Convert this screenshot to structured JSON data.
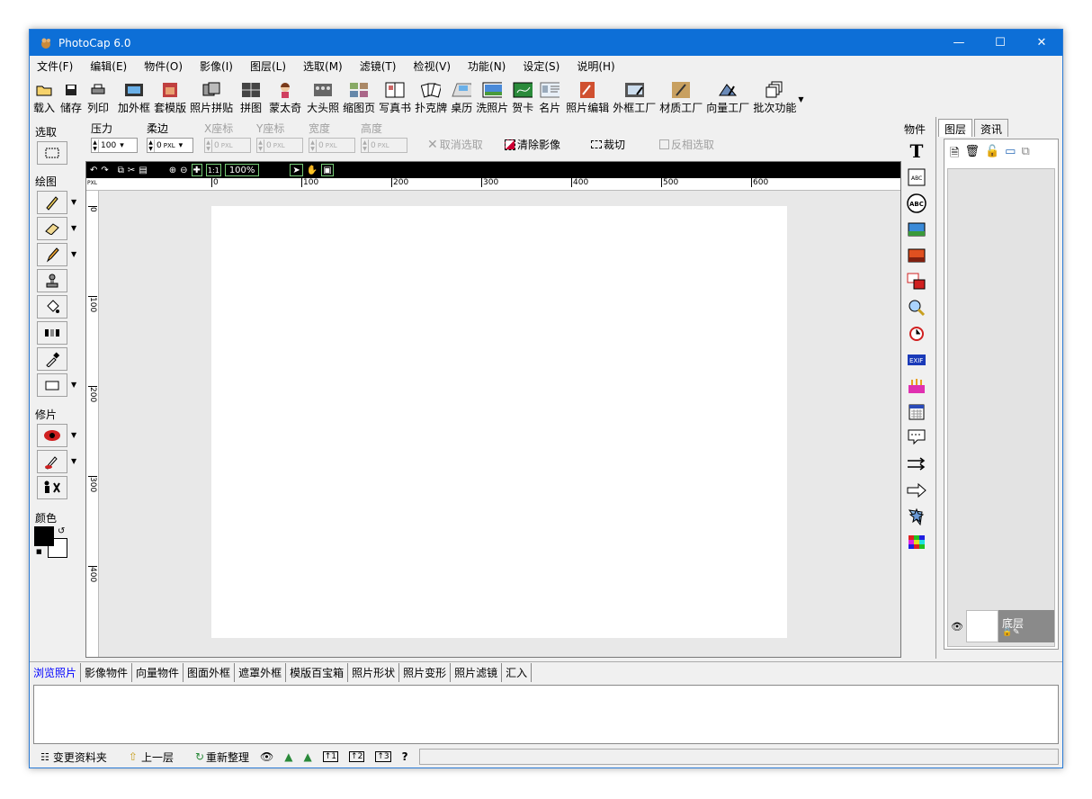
{
  "window": {
    "title": "PhotoCap 6.0",
    "controls": [
      "minimize-icon",
      "maximize-icon",
      "close-icon"
    ]
  },
  "menu": [
    "文件(F)",
    "编辑(E)",
    "物件(O)",
    "影像(I)",
    "图层(L)",
    "选取(M)",
    "滤镜(T)",
    "检视(V)",
    "功能(N)",
    "设定(S)",
    "说明(H)"
  ],
  "toolbar": [
    {
      "label": "载入",
      "icon": "open-folder-icon"
    },
    {
      "label": "储存",
      "icon": "save-icon"
    },
    {
      "label": "列印",
      "icon": "printer-icon"
    },
    {
      "label": "加外框",
      "icon": "frame-icon"
    },
    {
      "label": "套模版",
      "icon": "template-icon"
    },
    {
      "label": "照片拼贴",
      "icon": "collage-icon"
    },
    {
      "label": "拼图",
      "icon": "puzzle-icon"
    },
    {
      "label": "蒙太奇",
      "icon": "montage-icon"
    },
    {
      "label": "大头照",
      "icon": "id-photo-icon"
    },
    {
      "label": "缩图页",
      "icon": "thumbnail-page-icon"
    },
    {
      "label": "写真书",
      "icon": "photobook-icon"
    },
    {
      "label": "扑克牌",
      "icon": "poker-icon"
    },
    {
      "label": "桌历",
      "icon": "desk-calendar-icon"
    },
    {
      "label": "洗照片",
      "icon": "print-photo-icon"
    },
    {
      "label": "贺卡",
      "icon": "greeting-card-icon"
    },
    {
      "label": "名片",
      "icon": "business-card-icon"
    },
    {
      "label": "照片编辑",
      "icon": "photo-edit-icon"
    },
    {
      "label": "外框工厂",
      "icon": "frame-factory-icon"
    },
    {
      "label": "材质工厂",
      "icon": "texture-factory-icon"
    },
    {
      "label": "向量工厂",
      "icon": "vector-factory-icon"
    },
    {
      "label": "批次功能",
      "icon": "batch-icon"
    }
  ],
  "left_panel": {
    "select_label": "选取",
    "draw_label": "绘图",
    "retouch_label": "修片",
    "color_label": "颜色",
    "colors": {
      "foreground": "#000000",
      "background": "#ffffff"
    }
  },
  "props": {
    "pressure_label": "压力",
    "pressure_value": "100",
    "soft_label": "柔边",
    "soft_value": "0",
    "x_label": "X座标",
    "x_value": "0",
    "y_label": "Y座标",
    "y_value": "0",
    "width_label": "宽度",
    "width_value": "0",
    "height_label": "高度",
    "height_value": "0",
    "unit": "PXL",
    "cancel_select": "取消选取",
    "clear_image": "清除影像",
    "crop": "裁切",
    "invert_select": "反相选取"
  },
  "canvas": {
    "zoom": "100%",
    "ruler_unit": "PXL",
    "h_ticks": [
      "0",
      "100",
      "200",
      "300",
      "400",
      "500",
      "600"
    ],
    "v_ticks": [
      "0",
      "100",
      "200",
      "300",
      "400"
    ]
  },
  "objects_label": "物件",
  "right_panel": {
    "tab_layers": "图层",
    "tab_info": "资讯",
    "layer_name": "底层"
  },
  "bottom_tabs": [
    "浏览照片",
    "影像物件",
    "向量物件",
    "图面外框",
    "遮罩外框",
    "模版百宝箱",
    "照片形状",
    "照片变形",
    "照片滤镜",
    "汇入"
  ],
  "status": {
    "change_folder": "变更资料夹",
    "up_level": "上一层",
    "refresh": "重新整理",
    "help": "?"
  }
}
